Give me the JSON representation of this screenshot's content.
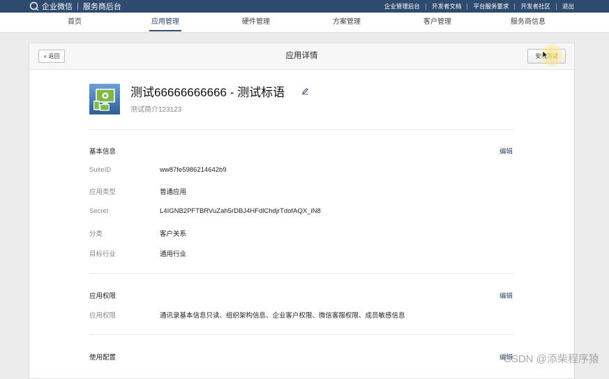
{
  "topbar": {
    "brand": "企业微信",
    "section": "服务商后台",
    "links": [
      "企业管理后台",
      "开发者文档",
      "平台服务要求",
      "开发者社区",
      "退出"
    ]
  },
  "nav": {
    "items": [
      "首页",
      "应用管理",
      "硬件管理",
      "方案管理",
      "客户管理",
      "服务商信息"
    ],
    "active": "应用管理"
  },
  "header": {
    "back_label": "« 返回",
    "title": "应用详情",
    "install_label": "安装测试"
  },
  "app": {
    "name": "测试66666666666 - 测试标语",
    "intro": "测试简介123123"
  },
  "basic": {
    "title": "基本信息",
    "edit_label": "编辑",
    "suite_id_label": "SuiteID",
    "suite_id": "ww87fe5986214642b9",
    "type_label": "应用类型",
    "type": "普通应用",
    "secret_label": "Secret",
    "secret": "L4IGNB2PFTBRVuZah5rDBJ4HFdlChdjrTdofAQX_iN8",
    "category_label": "分类",
    "category": "客户关系",
    "industry_label": "目标行业",
    "industry": "通用行业"
  },
  "permissions": {
    "title": "应用权限",
    "edit_label": "编辑",
    "label": "应用权限",
    "value": "通讯录基本信息只读、组织架构信息、企业客户权限、微信客服权限、成员敏感信息"
  },
  "usage": {
    "title": "使用配置",
    "edit_label": "编辑"
  },
  "watermark": "CSDN @添柴程序猿",
  "colors": {
    "topbar": "#2e4a6e",
    "accent": "#2e4a6e"
  }
}
